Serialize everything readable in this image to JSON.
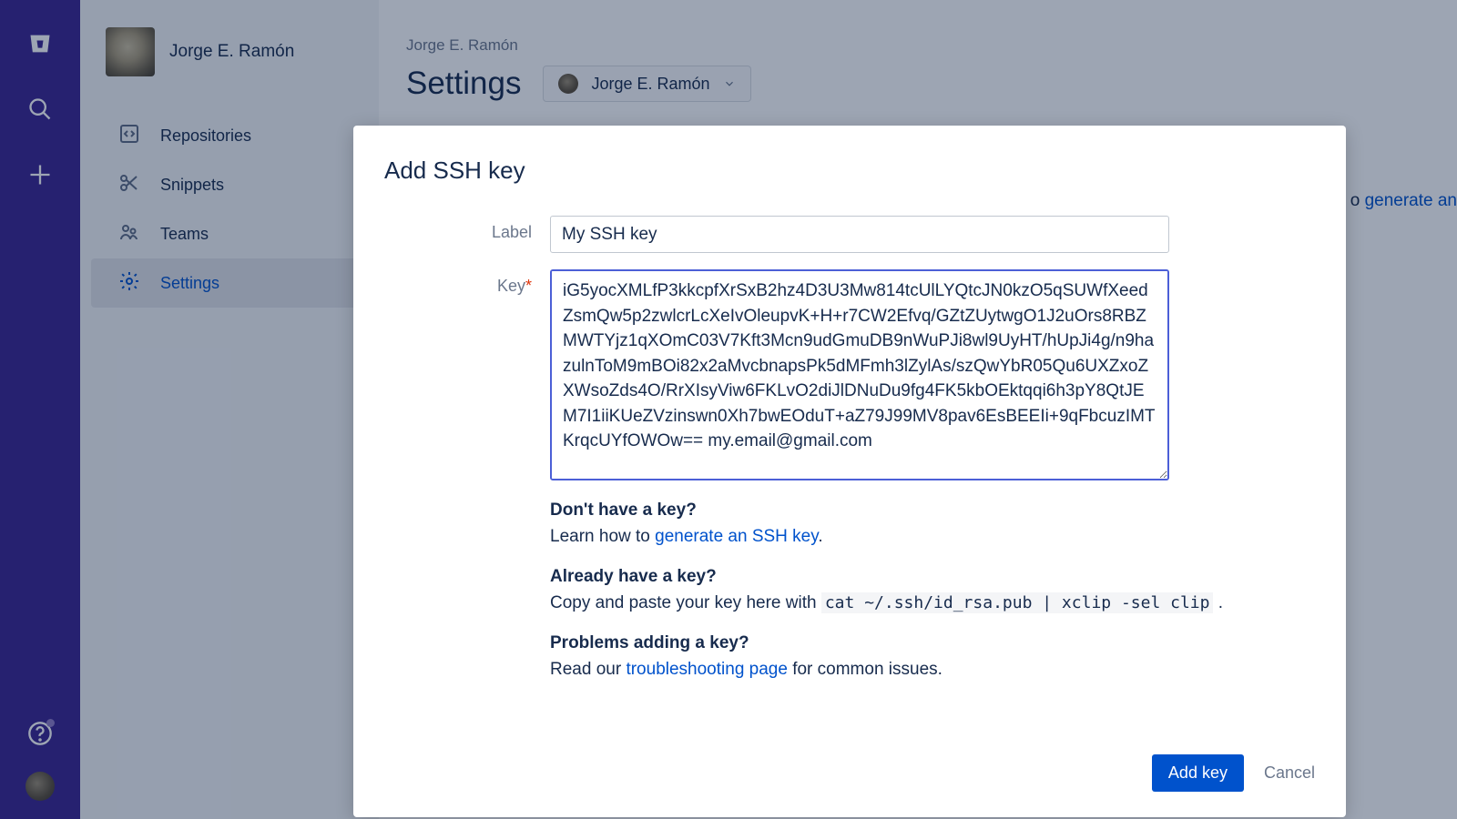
{
  "user": {
    "name": "Jorge E. Ramón"
  },
  "sidenav": {
    "items": [
      {
        "label": "Repositories"
      },
      {
        "label": "Snippets"
      },
      {
        "label": "Teams"
      },
      {
        "label": "Settings"
      }
    ]
  },
  "main": {
    "breadcrumb": "Jorge E. Ramón",
    "title": "Settings",
    "account_selector": "Jorge E. Ramón",
    "generate_frag_prefix": "o ",
    "generate_frag_link": "generate an"
  },
  "modal": {
    "title": "Add SSH key",
    "label_label": "Label",
    "label_value": "My SSH key",
    "key_label": "Key",
    "key_value": "iG5yocXMLfP3kkcpfXrSxB2hz4D3U3Mw814tcUlLYQtcJN0kzO5qSUWfXeedZsmQw5p2zwlcrLcXeIvOleupvK+H+r7CW2Efvq/GZtZUytwgO1J2uOrs8RBZMWTYjz1qXOmC03V7Kft3Mcn9udGmuDB9nWuPJi8wl9UyHT/hUpJi4g/n9hazulnToM9mBOi82x2aMvcbnapsPk5dMFmh3lZylAs/szQwYbR05Qu6UXZxoZXWsoZds4O/RrXIsyViw6FKLvO2diJlDNuDu9fg4FK5kbOEktqqi6h3pY8QtJEM7I1iiKUeZVzinswn0Xh7bwEOduT+aZ79J99MV8pav6EsBEEIi+9qFbcuzIMTKrqcUYfOWOw== my.email@gmail.com\n",
    "help": {
      "no_key_heading": "Don't have a key?",
      "no_key_prefix": "Learn how to ",
      "no_key_link": "generate an SSH key",
      "no_key_suffix": ".",
      "have_key_heading": "Already have a key?",
      "have_key_prefix": "Copy and paste your key here with ",
      "have_key_code": "cat ~/.ssh/id_rsa.pub | xclip -sel clip",
      "have_key_suffix": " .",
      "problems_heading": "Problems adding a key?",
      "problems_prefix": "Read our ",
      "problems_link": "troubleshooting page",
      "problems_suffix": " for common issues."
    },
    "actions": {
      "submit": "Add key",
      "cancel": "Cancel"
    }
  }
}
